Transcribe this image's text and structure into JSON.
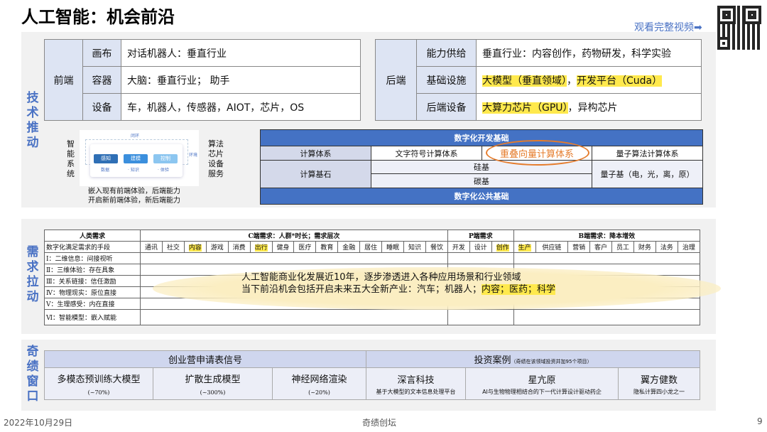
{
  "title": "人工智能：机会前沿",
  "video_link": "观看完整视频➡",
  "tech": {
    "side_label": "技术推动",
    "frontend": {
      "label": "前端",
      "rows": [
        {
          "k": "画布",
          "v": "对话机器人：垂直行业"
        },
        {
          "k": "容器",
          "v": "大脑：垂直行业； 助手"
        },
        {
          "k": "设备",
          "v": "车，机器人，传感器，AIOT，芯片，OS"
        }
      ]
    },
    "backend": {
      "label": "后端",
      "rows": [
        {
          "k": "能力供给",
          "v": "垂直行业：内容创作，药物研发，科学实验"
        },
        {
          "k": "基础设施",
          "v1": "大模型（垂直领域）",
          "sep": "，",
          "v2": "开发平台（Cuda）"
        },
        {
          "k": "后端设备",
          "v1": "大算力芯片（GPU）",
          "v2": "，异构芯片"
        }
      ]
    },
    "diagram": {
      "left": "智能系统",
      "right": "算法芯片设备服务",
      "loop": "闭环",
      "env": "环境",
      "steps": [
        "感知",
        "建模",
        "控制"
      ],
      "subs": [
        "数据",
        "· 知识",
        "· 体验"
      ],
      "caption1": "嵌入现有前端体验，后端能力",
      "caption2": "开启新前端体验，新后端能力"
    },
    "compute": {
      "top": "数字化开发基础",
      "bottom": "数字化公共基础",
      "r1": [
        "计算体系",
        "文字符号计算体系",
        "重叠向量计算体系",
        "量子算法计算体系"
      ],
      "r2_label": "计算基石",
      "silicon": "硅基",
      "carbon": "碳基",
      "quantum": "量子基（电，光，离，原）"
    }
  },
  "demand": {
    "side_label": "需求拉动",
    "h_human": "人类需求",
    "h_c": "C端需求：人群*时长；需求层次",
    "h_p": "P端需求",
    "h_b": "B端需求：降本增效",
    "means": "数字化满足需求的手段",
    "c_cols": [
      "通讯",
      "社交",
      "内容",
      "游戏",
      "消费",
      "出行",
      "健身",
      "医疗",
      "教育",
      "金融",
      "居住",
      "睡眠",
      "知识",
      "餐饮"
    ],
    "c_hl": [
      2,
      5
    ],
    "p_cols": [
      "开发",
      "设计",
      "创作"
    ],
    "p_hl": [
      2
    ],
    "b_cols": [
      "生产",
      "供应链",
      "营销",
      "客户",
      "员工",
      "财务",
      "法务",
      "治理"
    ],
    "b_hl": [
      0
    ],
    "levels": [
      "Ⅰ：二维信息：间接视听",
      "Ⅱ：三维体验：存在具象",
      "Ⅲ：关系链接：信任激励",
      "Ⅳ：物理现实：原位直接",
      "Ⅴ：生理感受：内在直接",
      "Ⅵ：智能模型：嵌入赋能"
    ],
    "note1": "人工智能商业化发展近10年，逐步渗透进入各种应用场景和行业领域",
    "note2a": "当下前沿机会包括开启未来五大全新产业：汽车；机器人；",
    "note2b": "内容；医药；科学"
  },
  "window": {
    "side_label": "奇绩窗口",
    "left_header": "创业营申请表信号",
    "right_header": "投资案例",
    "right_sub": "（奇绩在该领域投资并加95个项目）",
    "signals": [
      {
        "name": "多模态预训练大模型",
        "pct": "(~70%)"
      },
      {
        "name": "扩散生成模型",
        "pct": "(~300%)"
      },
      {
        "name": "神经网络渲染",
        "pct": "(~20%)"
      }
    ],
    "cases": [
      {
        "name": "深言科技",
        "desc": "基于大模型的文本信息处理平台"
      },
      {
        "name": "星亢原",
        "desc": "AI与生物物理相结合的下一代计算设计驱动药企"
      },
      {
        "name": "翼方健数",
        "desc": "隐私计算四小龙之一"
      }
    ]
  },
  "footer": {
    "date": "2022年10月29日",
    "brand": "奇绩创坛",
    "page": "9"
  }
}
